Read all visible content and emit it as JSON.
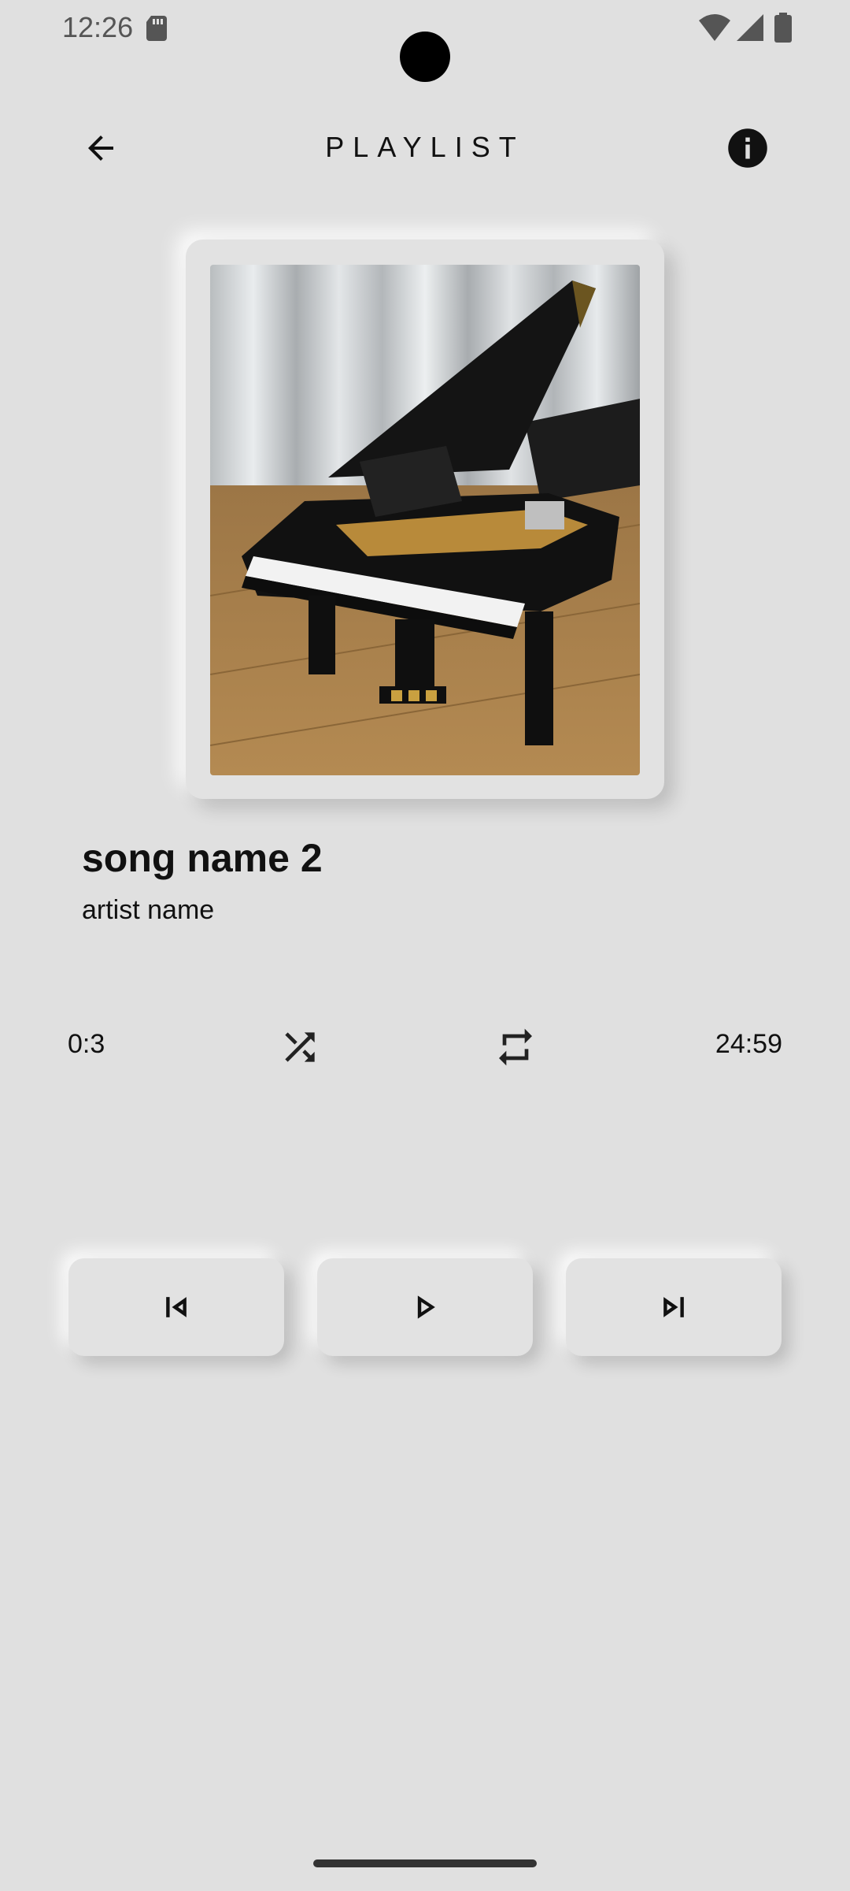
{
  "status_bar": {
    "time": "12:26",
    "icons": [
      "sd-card-icon",
      "wifi-icon",
      "signal-icon",
      "battery-icon"
    ]
  },
  "app_bar": {
    "title": "PLAYLIST",
    "back_icon": "arrow-back-icon",
    "info_icon": "info-icon"
  },
  "now_playing": {
    "album_art": "grand-piano-image",
    "song_name": "song name 2",
    "artist_name": "artist name"
  },
  "progress": {
    "current_time": "0:3",
    "total_time": "24:59"
  },
  "controls": {
    "icons": [
      "shuffle-icon",
      "repeat-icon",
      "skip-previous-icon",
      "play-icon",
      "skip-next-icon"
    ]
  },
  "colors": {
    "background": "#e0e0e0",
    "text": "#111111"
  }
}
